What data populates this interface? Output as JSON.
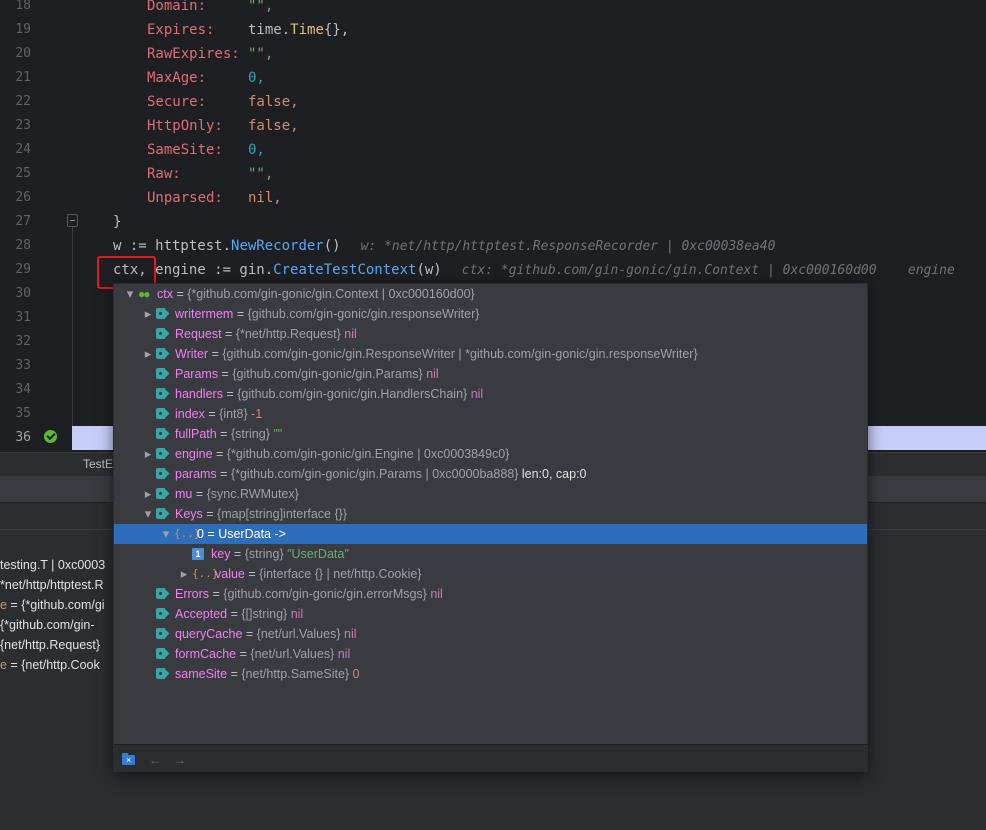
{
  "editor": {
    "lines": [
      {
        "n": "18",
        "field": "Domain:",
        "value": "\"\",",
        "kind": "str"
      },
      {
        "n": "19",
        "field": "Expires:",
        "value": "time.Time{},",
        "kind": "call"
      },
      {
        "n": "20",
        "field": "RawExpires:",
        "value": "\"\",",
        "kind": "str"
      },
      {
        "n": "21",
        "field": "MaxAge:",
        "value": "0,",
        "kind": "num"
      },
      {
        "n": "22",
        "field": "Secure:",
        "value": "false,",
        "kind": "kw"
      },
      {
        "n": "23",
        "field": "HttpOnly:",
        "value": "false,",
        "kind": "kw"
      },
      {
        "n": "24",
        "field": "SameSite:",
        "value": "0,",
        "kind": "num"
      },
      {
        "n": "25",
        "field": "Raw:",
        "value": "\"\",",
        "kind": "str"
      },
      {
        "n": "26",
        "field": "Unparsed:",
        "value": "nil,",
        "kind": "kw"
      }
    ],
    "line27": {
      "n": "27",
      "code": "}"
    },
    "line28": {
      "n": "28",
      "pre": "w := httptest.",
      "fn": "NewRecorder",
      "post": "()",
      "hint": "w: *net/http/httptest.ResponseRecorder | 0xc00038ea40"
    },
    "line29": {
      "n": "29",
      "pre": "ctx, engine := gin.",
      "fn": "CreateTestContext",
      "post": "(w)",
      "hint": "ctx: *github.com/gin-gonic/gin.Context | 0xc000160d00    engine"
    },
    "more_lines": [
      "30",
      "31",
      "32",
      "33",
      "34",
      "35",
      "36"
    ]
  },
  "bottom": {
    "tab_label": "TestE",
    "vars": [
      {
        "text": "testing.T | 0xc0003",
        "prefix": ""
      },
      {
        "text": "*net/http/httptest.R",
        "prefix": ""
      },
      {
        "text": " = {*github.com/gi",
        "prefix": "e"
      },
      {
        "text": "{*github.com/gin-",
        "prefix": ""
      },
      {
        "text": "{net/http.Request}",
        "prefix": ""
      },
      {
        "text": " = {net/http.Cook",
        "prefix": "e"
      }
    ]
  },
  "popup": {
    "rows": [
      {
        "arrow": "down",
        "icon": "infinity",
        "indent": 0,
        "name": "ctx",
        "type": "{*github.com/gin-gonic/gin.Context | 0xc000160d00}",
        "value": "",
        "vclass": ""
      },
      {
        "arrow": "right",
        "icon": "tag",
        "indent": 1,
        "name": "writermem",
        "type": "{github.com/gin-gonic/gin.responseWriter}",
        "value": "",
        "vclass": ""
      },
      {
        "arrow": "",
        "icon": "tag",
        "indent": 1,
        "name": "Request",
        "type": "{*net/http.Request}",
        "value": "nil",
        "vclass": "nil"
      },
      {
        "arrow": "right",
        "icon": "tag",
        "indent": 1,
        "name": "Writer",
        "type": "{github.com/gin-gonic/gin.ResponseWriter | *github.com/gin-gonic/gin.responseWriter}",
        "value": "",
        "vclass": ""
      },
      {
        "arrow": "",
        "icon": "tag",
        "indent": 1,
        "name": "Params",
        "type": "{github.com/gin-gonic/gin.Params}",
        "value": "nil",
        "vclass": "nil"
      },
      {
        "arrow": "",
        "icon": "tag",
        "indent": 1,
        "name": "handlers",
        "type": "{github.com/gin-gonic/gin.HandlersChain}",
        "value": "nil",
        "vclass": "nil"
      },
      {
        "arrow": "",
        "icon": "tag",
        "indent": 1,
        "name": "index",
        "type": "{int8}",
        "value": "-1",
        "vclass": "nv"
      },
      {
        "arrow": "",
        "icon": "tag",
        "indent": 1,
        "name": "fullPath",
        "type": "{string}",
        "value": "\"\"",
        "vclass": "sv"
      },
      {
        "arrow": "right",
        "icon": "tag",
        "indent": 1,
        "name": "engine",
        "type": "{*github.com/gin-gonic/gin.Engine | 0xc0003849c0}",
        "value": "",
        "vclass": ""
      },
      {
        "arrow": "",
        "icon": "tag",
        "indent": 1,
        "name": "params",
        "type": "{*github.com/gin-gonic/gin.Params | 0xc0000ba888}",
        "value": "len:0, cap:0",
        "vclass": "plain"
      },
      {
        "arrow": "right",
        "icon": "tag",
        "indent": 1,
        "name": "mu",
        "type": "{sync.RWMutex}",
        "value": "",
        "vclass": ""
      },
      {
        "arrow": "down",
        "icon": "tag",
        "indent": 1,
        "name": "Keys",
        "type": "{map[string]interface {}}",
        "value": "",
        "vclass": ""
      },
      {
        "arrow": "down",
        "icon": "brackets",
        "indent": 2,
        "name": "0 = UserData ->",
        "type": "",
        "value": "",
        "vclass": "",
        "selected": true
      },
      {
        "arrow": "",
        "icon": "one",
        "indent": 3,
        "name": "key",
        "type": "{string}",
        "value": "\"UserData\"",
        "vclass": "sv"
      },
      {
        "arrow": "right",
        "icon": "brackets",
        "indent": 3,
        "name": "value",
        "type": "{interface {} | net/http.Cookie}",
        "value": "",
        "vclass": ""
      },
      {
        "arrow": "",
        "icon": "tag",
        "indent": 1,
        "name": "Errors",
        "type": "{github.com/gin-gonic/gin.errorMsgs}",
        "value": "nil",
        "vclass": "nil"
      },
      {
        "arrow": "",
        "icon": "tag",
        "indent": 1,
        "name": "Accepted",
        "type": "{[]string}",
        "value": "nil",
        "vclass": "nil"
      },
      {
        "arrow": "",
        "icon": "tag",
        "indent": 1,
        "name": "queryCache",
        "type": "{net/url.Values}",
        "value": "nil",
        "vclass": "nil"
      },
      {
        "arrow": "",
        "icon": "tag",
        "indent": 1,
        "name": "formCache",
        "type": "{net/url.Values}",
        "value": "nil",
        "vclass": "nil"
      },
      {
        "arrow": "",
        "icon": "tag",
        "indent": 1,
        "name": "sameSite",
        "type": "{net/http.SameSite}",
        "value": "0",
        "vclass": "nv"
      }
    ],
    "footer": {
      "back": "←",
      "forward": "→"
    }
  }
}
